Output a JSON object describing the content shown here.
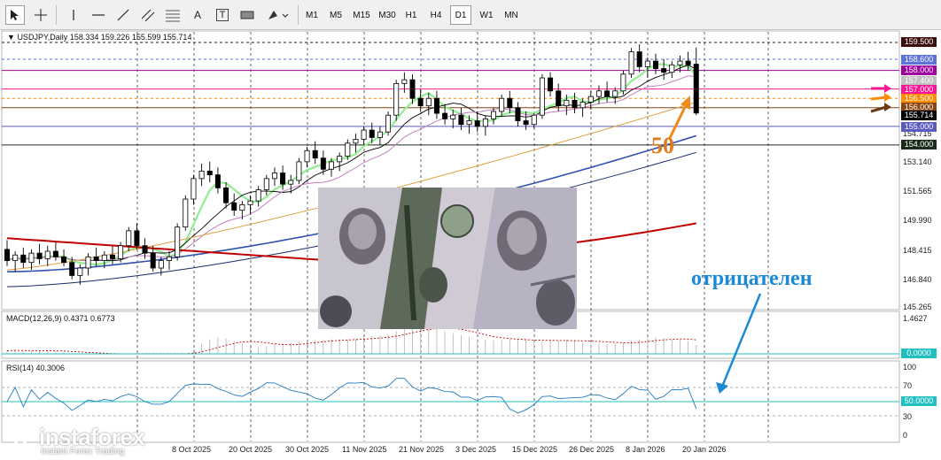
{
  "toolbar": {
    "tools": [
      "cursor-icon",
      "crosshair-icon",
      "vertical-line-icon",
      "horizontal-line-icon",
      "trendline-icon",
      "channel-icon",
      "fibonacci-icon",
      "text-icon",
      "label-icon",
      "rectangle-icon",
      "shapes-icon"
    ],
    "text_tool": "A",
    "label_tool": "T",
    "timeframes": [
      "M1",
      "M5",
      "M15",
      "M30",
      "H1",
      "H4",
      "D1",
      "W1",
      "MN"
    ],
    "active_timeframe": "D1"
  },
  "header": {
    "symbol": "USDJPY,Daily",
    "ohlc": "158.334 159.226 155.599 155.714"
  },
  "price_axis": [
    "159.500",
    "158.600",
    "158.000",
    "157.400",
    "157.000",
    "156.500",
    "156.000",
    "155.714",
    "155.000",
    "154.715",
    "154.000",
    "153.140",
    "151.565",
    "149.990",
    "148.415",
    "146.840",
    "145.265"
  ],
  "price_tags": [
    {
      "value": "159.500",
      "color": "#3b0d0d"
    },
    {
      "value": "158.600",
      "color": "#5b73d8"
    },
    {
      "value": "158.000",
      "color": "#a000a0"
    },
    {
      "value": "157.400",
      "color": "#c0c0c0"
    },
    {
      "value": "157.000",
      "color": "#ff1493"
    },
    {
      "value": "156.500",
      "color": "#ff8c00"
    },
    {
      "value": "156.000",
      "color": "#8b4513"
    },
    {
      "value": "155.714",
      "color": "#000000"
    },
    {
      "value": "155.000",
      "color": "#5b5bbf"
    },
    {
      "value": "154.000",
      "color": "#1a2b1a"
    }
  ],
  "macd": {
    "label": "MACD(12,26,9) 0.4371 0.6773",
    "axis": [
      "1.4627",
      "0.0000"
    ]
  },
  "rsi": {
    "label": "RSI(14) 40.3006",
    "axis": [
      "100",
      "70",
      "50.0000",
      "30",
      "0"
    ]
  },
  "dates": [
    "8 Oct 2025",
    "20 Oct 2025",
    "30 Oct 2025",
    "11 Nov 2025",
    "21 Nov 2025",
    "3 Dec 2025",
    "15 Dec 2025",
    "26 Dec 2025",
    "8 Jan 2026",
    "20 Jan 2026"
  ],
  "annotations": {
    "ma_period": "50",
    "word": "отрицателен"
  },
  "watermark": {
    "brand": "instaforex",
    "tagline": "Instant Forex Trading"
  },
  "chart_data": {
    "type": "candlestick",
    "symbol": "USDJPY",
    "timeframe": "Daily",
    "ylim": [
      145.265,
      159.5
    ],
    "last_close": 155.714,
    "candles_approx": [
      {
        "o": 148.4,
        "h": 148.9,
        "l": 147.5,
        "c": 147.8
      },
      {
        "o": 147.8,
        "h": 148.3,
        "l": 147.2,
        "c": 148.1
      },
      {
        "o": 148.1,
        "h": 148.5,
        "l": 147.4,
        "c": 147.7
      },
      {
        "o": 147.7,
        "h": 148.4,
        "l": 147.3,
        "c": 148.2
      },
      {
        "o": 148.2,
        "h": 148.7,
        "l": 147.6,
        "c": 147.9
      },
      {
        "o": 147.9,
        "h": 148.6,
        "l": 147.5,
        "c": 148.3
      },
      {
        "o": 148.3,
        "h": 148.8,
        "l": 147.8,
        "c": 148.0
      },
      {
        "o": 148.0,
        "h": 148.4,
        "l": 147.5,
        "c": 147.7
      },
      {
        "o": 147.7,
        "h": 148.0,
        "l": 146.8,
        "c": 147.0
      },
      {
        "o": 147.0,
        "h": 147.6,
        "l": 146.5,
        "c": 147.4
      },
      {
        "o": 147.4,
        "h": 148.2,
        "l": 147.0,
        "c": 148.0
      },
      {
        "o": 148.0,
        "h": 148.5,
        "l": 147.5,
        "c": 147.8
      },
      {
        "o": 147.8,
        "h": 148.3,
        "l": 147.4,
        "c": 148.1
      },
      {
        "o": 148.1,
        "h": 148.6,
        "l": 147.6,
        "c": 147.9
      },
      {
        "o": 147.9,
        "h": 148.8,
        "l": 147.7,
        "c": 148.6
      },
      {
        "o": 148.6,
        "h": 149.6,
        "l": 148.3,
        "c": 149.4
      },
      {
        "o": 149.4,
        "h": 149.8,
        "l": 148.4,
        "c": 148.6
      },
      {
        "o": 148.6,
        "h": 149.0,
        "l": 147.9,
        "c": 148.2
      },
      {
        "o": 148.2,
        "h": 148.6,
        "l": 147.2,
        "c": 147.4
      },
      {
        "o": 147.4,
        "h": 148.0,
        "l": 147.0,
        "c": 147.8
      },
      {
        "o": 147.8,
        "h": 148.3,
        "l": 147.3,
        "c": 148.0
      },
      {
        "o": 148.0,
        "h": 149.8,
        "l": 147.8,
        "c": 149.6
      },
      {
        "o": 149.6,
        "h": 151.3,
        "l": 149.4,
        "c": 151.1
      },
      {
        "o": 151.1,
        "h": 152.4,
        "l": 150.8,
        "c": 152.2
      },
      {
        "o": 152.2,
        "h": 153.0,
        "l": 151.8,
        "c": 152.6
      },
      {
        "o": 152.6,
        "h": 153.1,
        "l": 152.0,
        "c": 152.4
      },
      {
        "o": 152.4,
        "h": 152.8,
        "l": 151.4,
        "c": 151.7
      },
      {
        "o": 151.7,
        "h": 152.0,
        "l": 150.6,
        "c": 150.9
      },
      {
        "o": 150.9,
        "h": 151.4,
        "l": 150.2,
        "c": 150.5
      },
      {
        "o": 150.5,
        "h": 151.0,
        "l": 150.0,
        "c": 150.8
      },
      {
        "o": 150.8,
        "h": 151.3,
        "l": 150.3,
        "c": 151.0
      },
      {
        "o": 151.0,
        "h": 151.8,
        "l": 150.7,
        "c": 151.6
      },
      {
        "o": 151.6,
        "h": 152.4,
        "l": 151.3,
        "c": 152.2
      },
      {
        "o": 152.2,
        "h": 152.8,
        "l": 151.8,
        "c": 152.5
      },
      {
        "o": 152.5,
        "h": 152.9,
        "l": 151.6,
        "c": 151.9
      },
      {
        "o": 151.9,
        "h": 152.4,
        "l": 151.4,
        "c": 152.1
      },
      {
        "o": 152.1,
        "h": 153.3,
        "l": 151.9,
        "c": 153.1
      },
      {
        "o": 153.1,
        "h": 153.9,
        "l": 152.8,
        "c": 153.7
      },
      {
        "o": 153.7,
        "h": 154.2,
        "l": 153.0,
        "c": 153.3
      },
      {
        "o": 153.3,
        "h": 153.7,
        "l": 152.4,
        "c": 152.7
      },
      {
        "o": 152.7,
        "h": 153.3,
        "l": 152.3,
        "c": 153.1
      },
      {
        "o": 153.1,
        "h": 153.6,
        "l": 152.6,
        "c": 153.4
      },
      {
        "o": 153.4,
        "h": 154.3,
        "l": 153.2,
        "c": 154.1
      },
      {
        "o": 154.1,
        "h": 154.6,
        "l": 153.6,
        "c": 154.3
      },
      {
        "o": 154.3,
        "h": 155.0,
        "l": 154.0,
        "c": 154.8
      },
      {
        "o": 154.8,
        "h": 155.2,
        "l": 154.1,
        "c": 154.4
      },
      {
        "o": 154.4,
        "h": 155.0,
        "l": 154.0,
        "c": 154.7
      },
      {
        "o": 154.7,
        "h": 155.8,
        "l": 154.5,
        "c": 155.6
      },
      {
        "o": 155.6,
        "h": 157.5,
        "l": 155.3,
        "c": 157.3
      },
      {
        "o": 157.3,
        "h": 157.9,
        "l": 156.8,
        "c": 157.5
      },
      {
        "o": 157.5,
        "h": 157.8,
        "l": 156.2,
        "c": 156.5
      },
      {
        "o": 156.5,
        "h": 157.0,
        "l": 155.8,
        "c": 156.1
      },
      {
        "o": 156.1,
        "h": 156.8,
        "l": 155.6,
        "c": 156.5
      },
      {
        "o": 156.5,
        "h": 156.9,
        "l": 155.4,
        "c": 155.7
      },
      {
        "o": 155.7,
        "h": 156.2,
        "l": 155.1,
        "c": 155.4
      },
      {
        "o": 155.4,
        "h": 155.9,
        "l": 154.9,
        "c": 155.6
      },
      {
        "o": 155.6,
        "h": 156.0,
        "l": 154.8,
        "c": 155.1
      },
      {
        "o": 155.1,
        "h": 155.6,
        "l": 154.6,
        "c": 155.3
      },
      {
        "o": 155.3,
        "h": 155.8,
        "l": 154.7,
        "c": 155.0
      },
      {
        "o": 155.0,
        "h": 155.6,
        "l": 154.5,
        "c": 155.4
      },
      {
        "o": 155.4,
        "h": 156.0,
        "l": 155.1,
        "c": 155.8
      },
      {
        "o": 155.8,
        "h": 156.7,
        "l": 155.5,
        "c": 156.5
      },
      {
        "o": 156.5,
        "h": 156.9,
        "l": 155.7,
        "c": 156.0
      },
      {
        "o": 156.0,
        "h": 156.3,
        "l": 155.0,
        "c": 155.3
      },
      {
        "o": 155.3,
        "h": 155.8,
        "l": 154.8,
        "c": 155.1
      },
      {
        "o": 155.1,
        "h": 155.7,
        "l": 154.9,
        "c": 155.6
      },
      {
        "o": 155.6,
        "h": 157.8,
        "l": 155.4,
        "c": 157.6
      },
      {
        "o": 157.6,
        "h": 157.9,
        "l": 156.6,
        "c": 156.9
      },
      {
        "o": 156.9,
        "h": 157.3,
        "l": 155.8,
        "c": 156.1
      },
      {
        "o": 156.1,
        "h": 156.7,
        "l": 155.6,
        "c": 156.4
      },
      {
        "o": 156.4,
        "h": 156.8,
        "l": 155.7,
        "c": 156.0
      },
      {
        "o": 156.0,
        "h": 156.5,
        "l": 155.5,
        "c": 156.3
      },
      {
        "o": 156.3,
        "h": 156.9,
        "l": 155.9,
        "c": 156.6
      },
      {
        "o": 156.6,
        "h": 157.2,
        "l": 156.2,
        "c": 156.9
      },
      {
        "o": 156.9,
        "h": 157.4,
        "l": 156.3,
        "c": 156.6
      },
      {
        "o": 156.6,
        "h": 157.1,
        "l": 156.2,
        "c": 156.9
      },
      {
        "o": 156.9,
        "h": 158.0,
        "l": 156.7,
        "c": 157.8
      },
      {
        "o": 157.8,
        "h": 159.2,
        "l": 157.6,
        "c": 159.0
      },
      {
        "o": 159.0,
        "h": 159.4,
        "l": 157.9,
        "c": 158.2
      },
      {
        "o": 158.2,
        "h": 158.7,
        "l": 157.6,
        "c": 158.5
      },
      {
        "o": 158.5,
        "h": 158.9,
        "l": 157.8,
        "c": 158.1
      },
      {
        "o": 158.1,
        "h": 158.6,
        "l": 157.5,
        "c": 157.9
      },
      {
        "o": 157.9,
        "h": 158.5,
        "l": 157.6,
        "c": 158.3
      },
      {
        "o": 158.3,
        "h": 158.8,
        "l": 157.9,
        "c": 158.5
      },
      {
        "o": 158.5,
        "h": 159.0,
        "l": 158.0,
        "c": 158.3
      },
      {
        "o": 158.334,
        "h": 159.226,
        "l": 155.599,
        "c": 155.714
      }
    ],
    "moving_averages": [
      {
        "name": "fast",
        "color": "#90ee90"
      },
      {
        "name": "slow",
        "color": "#000000"
      },
      {
        "name": "mid",
        "color": "#c080c0"
      },
      {
        "name": "ma50",
        "color": "#e0a040"
      },
      {
        "name": "ma100",
        "color": "#3050b0"
      },
      {
        "name": "ma200",
        "color": "#c00000"
      }
    ],
    "horizontal_levels": [
      159.5,
      158.6,
      158.0,
      157.0,
      156.5,
      156.0,
      155.0,
      154.0
    ],
    "macd": {
      "value": 0.4371,
      "signal": 0.6773
    },
    "rsi": {
      "value": 40.3006,
      "levels": [
        70,
        50,
        30
      ]
    }
  }
}
